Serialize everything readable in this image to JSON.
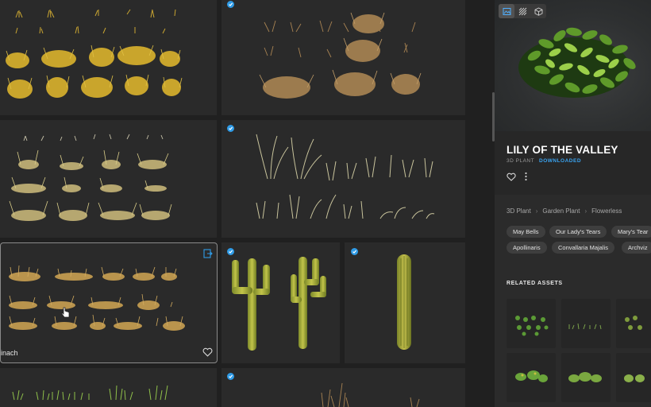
{
  "grid": {
    "hovered_asset_name": "inach"
  },
  "panel": {
    "title": "LILY OF THE VALLEY",
    "type_label": "3D PLANT",
    "status_label": "DOWNLOADED",
    "breadcrumb": [
      "3D Plant",
      "Garden Plant",
      "Flowerless"
    ],
    "tags": [
      "May Bells",
      "Our Lady's Tears",
      "Mary's Tear",
      "Apollinaris",
      "Convallaria Majalis",
      "Archviz"
    ],
    "related_heading": "RELATED ASSETS",
    "view_modes": [
      "image-icon",
      "texture-icon",
      "cube-icon"
    ]
  },
  "colors": {
    "accent": "#2f9be6",
    "status": "#3aa3f0",
    "background": "#202020",
    "tile": "#2a2a2a"
  }
}
